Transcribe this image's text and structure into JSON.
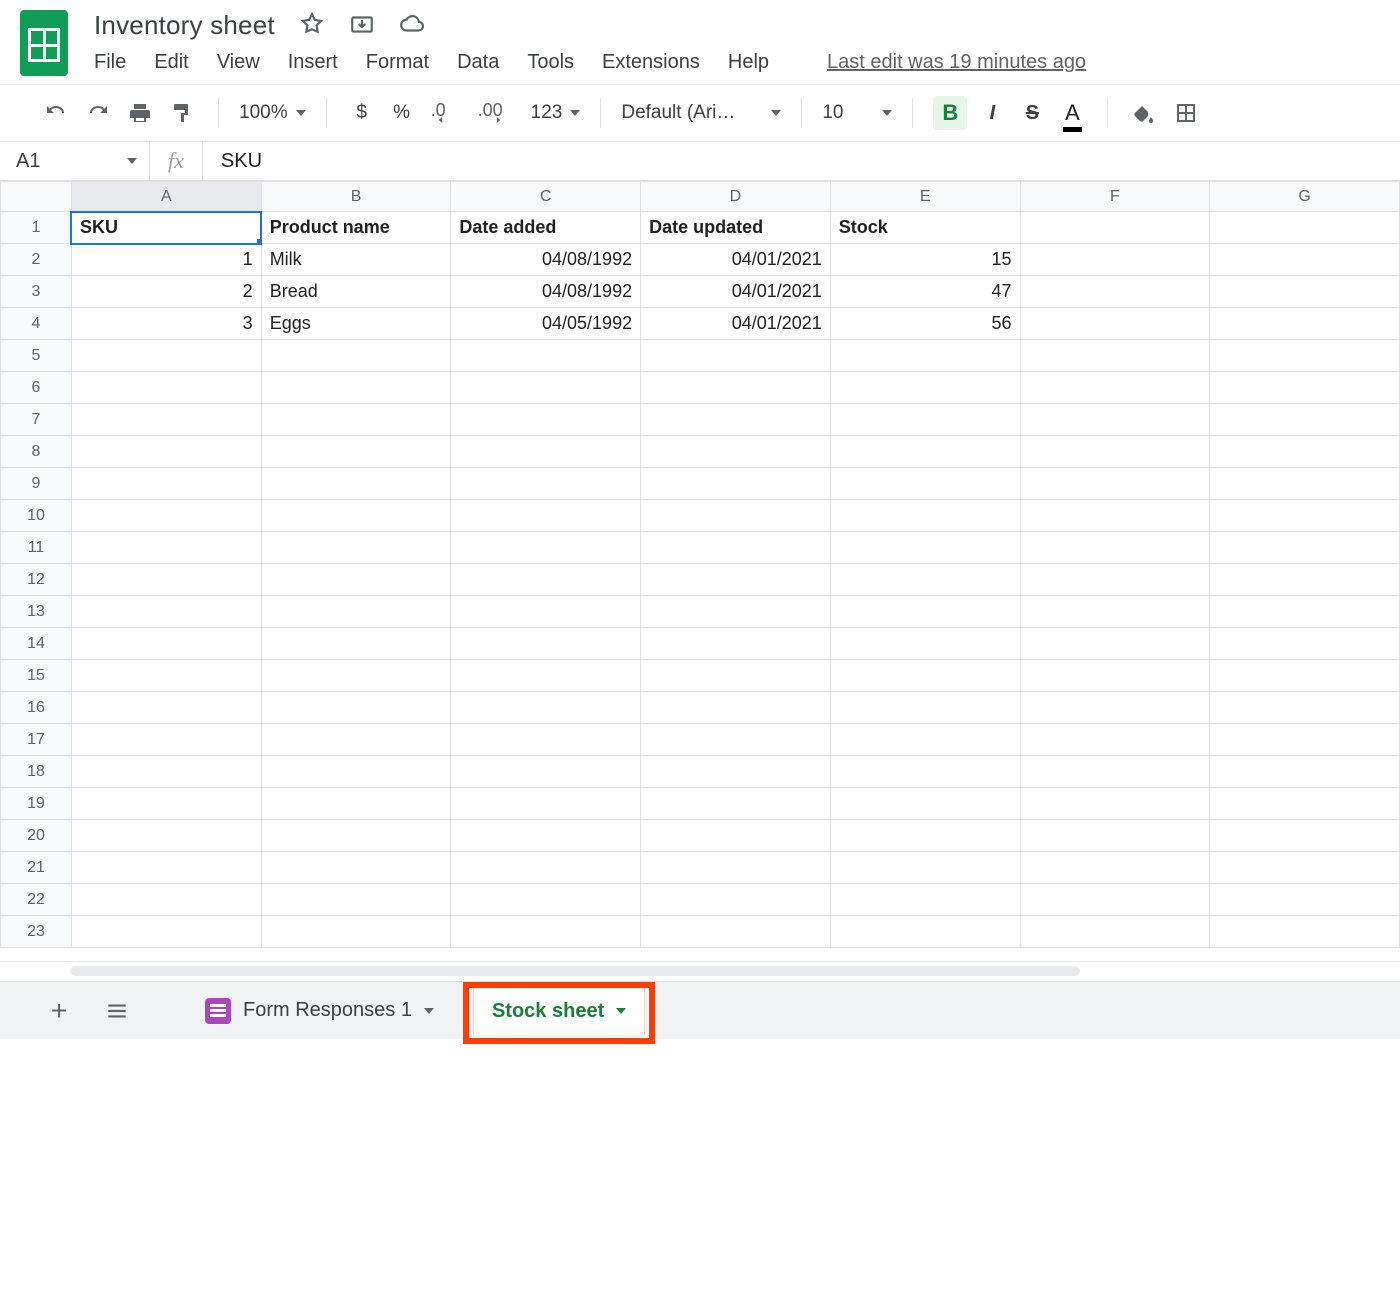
{
  "doc": {
    "title": "Inventory sheet"
  },
  "menu": {
    "file": "File",
    "edit": "Edit",
    "view": "View",
    "insert": "Insert",
    "format": "Format",
    "data": "Data",
    "tools": "Tools",
    "extensions": "Extensions",
    "help": "Help",
    "last_edit": "Last edit was 19 minutes ago"
  },
  "toolbar": {
    "zoom": "100%",
    "currency": "$",
    "percent": "%",
    "dec_less": ".0",
    "dec_more": ".00",
    "more_formats": "123",
    "font": "Default (Ari…",
    "font_size": "10",
    "bold": "B",
    "italic": "I",
    "strike": "S",
    "text_color": "A"
  },
  "fx": {
    "cell_ref": "A1",
    "fx_label": "fx",
    "formula": "SKU"
  },
  "columns": [
    "A",
    "B",
    "C",
    "D",
    "E",
    "F",
    "G"
  ],
  "row_count": 23,
  "headers": {
    "A": "SKU",
    "B": "Product name",
    "C": "Date added",
    "D": "Date updated",
    "E": "Stock"
  },
  "rows": [
    {
      "A": "1",
      "B": "Milk",
      "C": "04/08/1992",
      "D": "04/01/2021",
      "E": "15"
    },
    {
      "A": "2",
      "B": "Bread",
      "C": "04/08/1992",
      "D": "04/01/2021",
      "E": "47"
    },
    {
      "A": "3",
      "B": "Eggs",
      "C": "04/05/1992",
      "D": "04/01/2021",
      "E": "56"
    }
  ],
  "tabs": {
    "form_responses": "Form Responses 1",
    "stock_sheet": "Stock sheet"
  }
}
